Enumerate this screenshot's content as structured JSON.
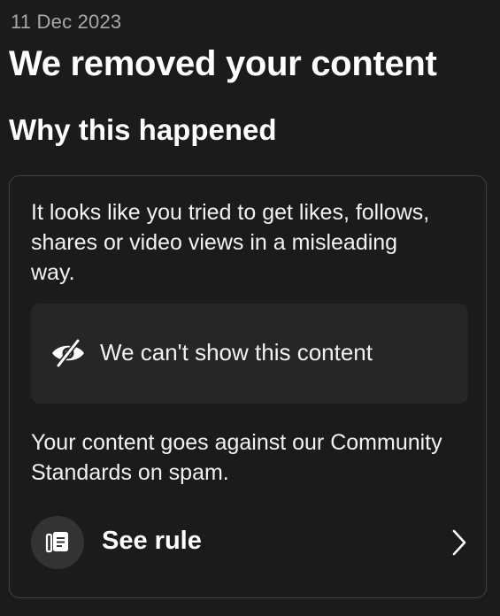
{
  "header": {
    "date": "11 Dec 2023",
    "title": "We removed your content",
    "section_title": "Why this happened"
  },
  "card": {
    "intro_text": "It looks like you tried to get likes, follows, shares or video views in a misleading way.",
    "hidden_content": {
      "icon": "eye-off-icon",
      "label": "We can't show this content"
    },
    "violation_text": "Your content goes against our Community Standards on spam.",
    "rule_link": {
      "icon": "rulebook-icon",
      "label": "See rule",
      "chevron_icon": "chevron-right-icon"
    }
  },
  "colors": {
    "background": "#1b1b1b",
    "muted_text": "#a8a8a8",
    "card_border": "#3f3f3f",
    "hidden_box_bg": "#262626"
  }
}
